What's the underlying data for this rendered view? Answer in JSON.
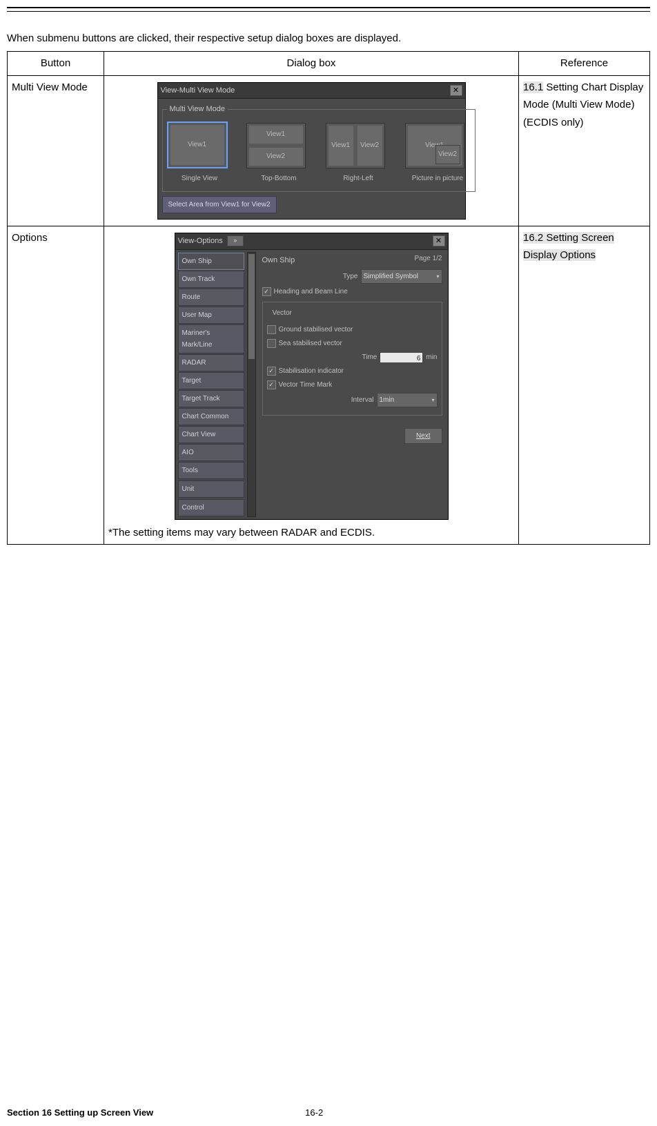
{
  "intro": "When submenu buttons are clicked, their respective setup dialog boxes are displayed.",
  "headers": {
    "button": "Button",
    "dialog": "Dialog box",
    "reference": "Reference"
  },
  "rows": {
    "multiview": {
      "button": "Multi View Mode",
      "reference_hl": "16.1",
      "reference_rest": " Setting Chart Display Mode (Multi View Mode) (ECDIS only)",
      "dlg": {
        "title": "View-Multi View Mode",
        "legend": "Multi View Mode",
        "opts": [
          {
            "cells": [
              "View1"
            ],
            "caption": "Single View",
            "layout": "single",
            "selected": true
          },
          {
            "cells": [
              "View1",
              "View2"
            ],
            "caption": "Top-Bottom",
            "layout": "tb"
          },
          {
            "cells": [
              "View1",
              "View2"
            ],
            "caption": "Right-Left",
            "layout": "rl"
          },
          {
            "cells": [
              "View1",
              "View2"
            ],
            "caption": "Picture in picture",
            "layout": "pip"
          }
        ],
        "bottom_btn": "Select Area from View1 for View2"
      }
    },
    "options": {
      "button": "Options",
      "reference_hl": "16.2 Setting Screen Display Options",
      "footnote": "*The setting items may vary between RADAR and ECDIS.",
      "dlg": {
        "title": "View-Options",
        "page": "Page 1/2",
        "side_items": [
          "Own Ship",
          "Own Track",
          "Route",
          "User Map",
          "Mariner's Mark/Line",
          "RADAR",
          "Target",
          "Target Track",
          "Chart Common",
          "Chart View",
          "AIO",
          "Tools"
        ],
        "side_items2": [
          "Unit"
        ],
        "side_items3": [
          "Control"
        ],
        "panel_title": "Own Ship",
        "type_label": "Type",
        "type_value": "Simplified Symbol",
        "heading_chk": {
          "checked": true,
          "label": "Heading and Beam Line"
        },
        "vector_legend": "Vector",
        "ground_chk": {
          "checked": false,
          "label": "Ground stabilised vector"
        },
        "sea_chk": {
          "checked": false,
          "label": "Sea stabilised vector"
        },
        "time_label": "Time",
        "time_value": "6",
        "time_unit": "min",
        "stab_chk": {
          "checked": true,
          "label": "Stabilisation indicator"
        },
        "vtm_chk": {
          "checked": true,
          "label": "Vector Time Mark"
        },
        "interval_label": "Interval",
        "interval_value": "1min",
        "next": "Next"
      }
    }
  },
  "footer": {
    "section": "Section 16    Setting up Screen View",
    "page": "16-2"
  }
}
